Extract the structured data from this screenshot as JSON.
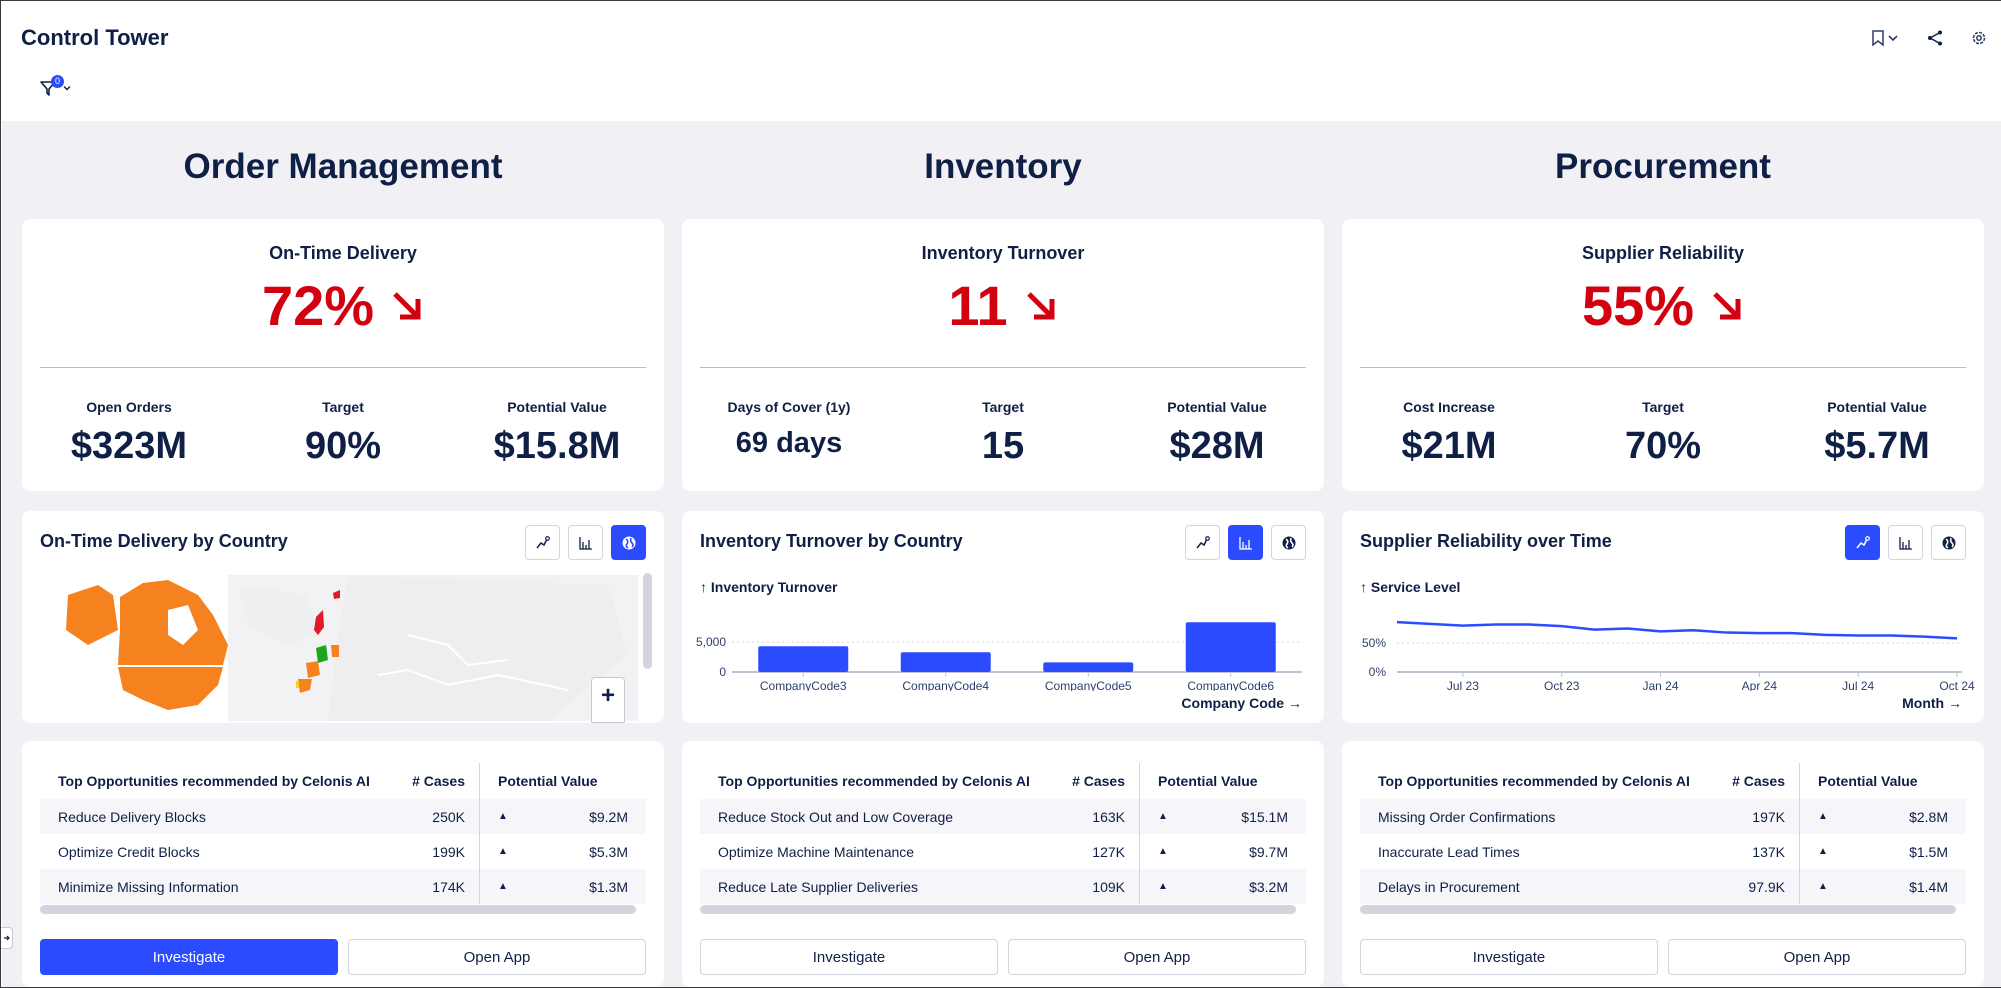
{
  "header": {
    "title": "Control Tower",
    "filter_count": "0",
    "icons": [
      "bookmark-icon",
      "chevron-down-icon",
      "share-icon",
      "gear-icon"
    ]
  },
  "colors": {
    "accent": "#2b4bff",
    "negative": "#d3000f",
    "text": "#0f1f45",
    "map_orange": "#f5821f",
    "map_red": "#e0192b",
    "map_green": "#1aa81a",
    "map_neutral": "#efeff2"
  },
  "sections": [
    {
      "title": "Order Management",
      "kpi": {
        "label": "On-Time Delivery",
        "value": "72%",
        "trend": "down",
        "trend_icon": "arrow-down-right-icon",
        "sub": [
          {
            "label": "Open Orders",
            "value": "$323M"
          },
          {
            "label": "Target",
            "value": "90%"
          },
          {
            "label": "Potential Value",
            "value": "$15.8M"
          }
        ]
      },
      "chart": {
        "title": "On-Time Delivery by Country",
        "active_view": "map",
        "views": [
          "line",
          "bar",
          "map"
        ],
        "zoom_in_label": "+"
      },
      "opportunities": {
        "headers": [
          "Top Opportunities recommended by Celonis AI",
          "# Cases",
          "Potential Value"
        ],
        "rows": [
          {
            "name": "Reduce Delivery Blocks",
            "cases": "250K",
            "value": "$9.2M"
          },
          {
            "name": "Optimize Credit Blocks",
            "cases": "199K",
            "value": "$5.3M"
          },
          {
            "name": "Minimize Missing Information",
            "cases": "174K",
            "value": "$1.3M"
          }
        ],
        "buttons": [
          {
            "label": "Investigate",
            "primary": true
          },
          {
            "label": "Open App",
            "primary": false
          }
        ]
      }
    },
    {
      "title": "Inventory",
      "kpi": {
        "label": "Inventory Turnover",
        "value": "11",
        "trend": "down",
        "trend_icon": "arrow-down-right-icon",
        "sub": [
          {
            "label": "Days of Cover (1y)",
            "value": "69 days"
          },
          {
            "label": "Target",
            "value": "15"
          },
          {
            "label": "Potential Value",
            "value": "$28M"
          }
        ]
      },
      "chart": {
        "title": "Inventory Turnover by Country",
        "active_view": "bar",
        "views": [
          "line",
          "bar",
          "map"
        ]
      },
      "opportunities": {
        "headers": [
          "Top Opportunities recommended by Celonis AI",
          "# Cases",
          "Potential Value"
        ],
        "rows": [
          {
            "name": "Reduce Stock Out and Low Coverage",
            "cases": "163K",
            "value": "$15.1M"
          },
          {
            "name": "Optimize Machine Maintenance",
            "cases": "127K",
            "value": "$9.7M"
          },
          {
            "name": "Reduce Late Supplier Deliveries",
            "cases": "109K",
            "value": "$3.2M"
          }
        ],
        "buttons": [
          {
            "label": "Investigate",
            "primary": false
          },
          {
            "label": "Open App",
            "primary": false
          }
        ]
      }
    },
    {
      "title": "Procurement",
      "kpi": {
        "label": "Supplier Reliability",
        "value": "55%",
        "trend": "down",
        "trend_icon": "arrow-down-right-icon",
        "sub": [
          {
            "label": "Cost Increase",
            "value": "$21M"
          },
          {
            "label": "Target",
            "value": "70%"
          },
          {
            "label": "Potential Value",
            "value": "$5.7M"
          }
        ]
      },
      "chart": {
        "title": "Supplier Reliability over Time",
        "active_view": "line",
        "views": [
          "line",
          "bar",
          "map"
        ]
      },
      "opportunities": {
        "headers": [
          "Top Opportunities recommended by Celonis AI",
          "# Cases",
          "Potential Value"
        ],
        "rows": [
          {
            "name": "Missing Order Confirmations",
            "cases": "197K",
            "value": "$2.8M"
          },
          {
            "name": "Inaccurate Lead Times",
            "cases": "137K",
            "value": "$1.5M"
          },
          {
            "name": "Delays in Procurement",
            "cases": "97.9K",
            "value": "$1.4M"
          }
        ],
        "buttons": [
          {
            "label": "Investigate",
            "primary": false
          },
          {
            "label": "Open App",
            "primary": false
          }
        ]
      }
    }
  ],
  "chart_data": [
    {
      "type": "bar",
      "title": "Inventory Turnover by Country",
      "ylabel": "↑ Inventory Turnover",
      "xlabel": "Company Code →",
      "categories": [
        "CompanyCode3",
        "CompanyCode4",
        "CompanyCode5",
        "CompanyCode6"
      ],
      "values": [
        4300,
        3300,
        1600,
        8300
      ],
      "yticks": [
        "0",
        "5,000"
      ],
      "ylim": [
        0,
        9000
      ],
      "grid": true
    },
    {
      "type": "line",
      "title": "Supplier Reliability over Time",
      "ylabel": "↑ Service Level",
      "xlabel": "Month →",
      "x": [
        "May 23",
        "Jun 23",
        "Jul 23",
        "Aug 23",
        "Sep 23",
        "Oct 23",
        "Nov 23",
        "Dec 23",
        "Jan 24",
        "Feb 24",
        "Mar 24",
        "Apr 24",
        "May 24",
        "Jun 24",
        "Jul 24",
        "Aug 24",
        "Sep 24",
        "Oct 24"
      ],
      "series": [
        {
          "name": "Service Level",
          "values": [
            86,
            83,
            80,
            82,
            82,
            79,
            73,
            75,
            70,
            72,
            68,
            67,
            67,
            64,
            63,
            63,
            61,
            58
          ]
        }
      ],
      "xticks": [
        "Jul 23",
        "Oct 23",
        "Jan 24",
        "Apr 24",
        "Jul 24",
        "Oct 24"
      ],
      "yticks": [
        "0%",
        "50%"
      ],
      "ylim": [
        0,
        100
      ],
      "grid": true
    }
  ]
}
